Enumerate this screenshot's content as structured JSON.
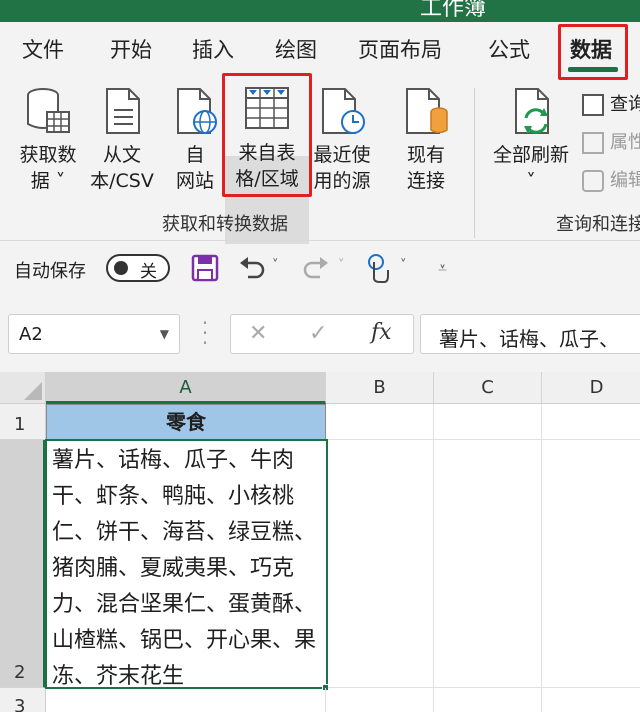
{
  "window": {
    "title_partial": "工作簿"
  },
  "ribbon_tabs": [
    "文件",
    "开始",
    "插入",
    "绘图",
    "页面布局",
    "公式",
    "数据"
  ],
  "active_tab": "数据",
  "get_transform_group": {
    "label": "获取和转换数据",
    "buttons": [
      {
        "line1": "获取数",
        "line2": "据 ˅",
        "icon": "database-table-icon"
      },
      {
        "line1": "从文",
        "line2": "本/CSV",
        "icon": "text-file-icon"
      },
      {
        "line1": "自",
        "line2": "网站",
        "icon": "web-globe-icon"
      },
      {
        "line1": "来自表",
        "line2": "格/区域",
        "icon": "table-range-icon"
      },
      {
        "line1": "最近使",
        "line2": "用的源",
        "icon": "recent-sources-icon"
      },
      {
        "line1": "现有",
        "line2": "连接",
        "icon": "existing-connections-icon"
      }
    ]
  },
  "queries_group": {
    "label": "查询和连接",
    "refresh_all": {
      "line1": "全部刷新",
      "line2": "˅"
    },
    "small_items": [
      "查询",
      "属性",
      "编辑"
    ]
  },
  "qat": {
    "autosave_label": "自动保存",
    "toggle_state": "关"
  },
  "name_box": "A2",
  "formula_bar": {
    "fx": "fx",
    "value": "薯片、话梅、瓜子、"
  },
  "columns": [
    "A",
    "B",
    "C",
    "D"
  ],
  "rows": [
    "1",
    "2",
    "3"
  ],
  "cells": {
    "A1": "零食",
    "A2": "薯片、话梅、瓜子、牛肉干、虾条、鸭肫、小核桃仁、饼干、海苔、绿豆糕、猪肉脯、夏威夷果、巧克力、混合坚果仁、蛋黄酥、山楂糕、锅巴、开心果、果冻、芥末花生"
  },
  "colors": {
    "accent_green": "#217346",
    "header_fill_a1": "#9fc6e7",
    "highlight_red": "#e02020"
  }
}
